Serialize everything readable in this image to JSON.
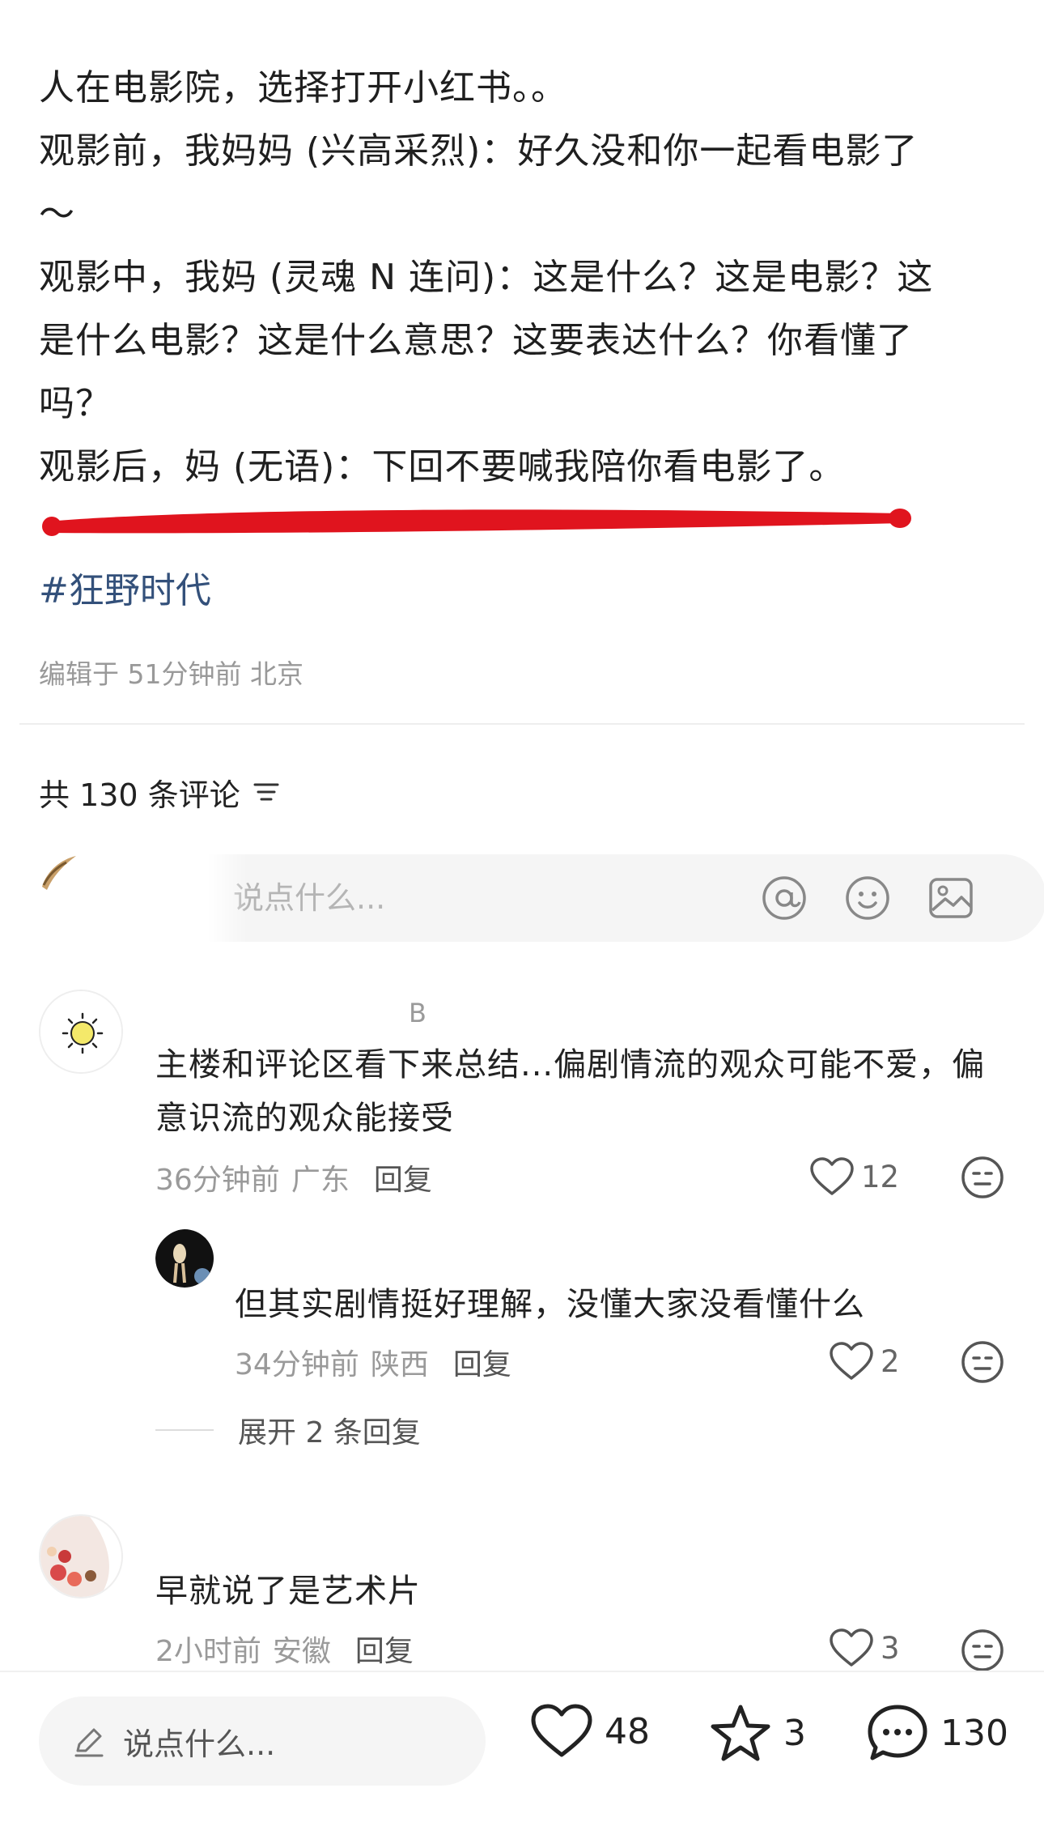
{
  "post": {
    "lines": [
      "人在电影院，选择打开小红书。。",
      "观影前，我妈妈 (兴高采烈)：好久没和你一起看电影了",
      "～",
      "观影中，我妈 (灵魂 N 连问)：这是什么？这是电影？这",
      "是什么电影？这是什么意思？这要表达什么？你看懂了",
      "吗？",
      "观影后，妈 (无语)：下回不要喊我陪你看电影了。"
    ],
    "hashtag": "#狂野时代",
    "meta": "编辑于 51分钟前 北京"
  },
  "comments_header": {
    "label": "共 130 条评论"
  },
  "comment_input": {
    "placeholder": "说点什么..."
  },
  "comments": [
    {
      "username": "B",
      "text_lines": [
        "主楼和评论区看下来总结...偏剧情流的观众可能不爱，偏",
        "意识流的观众能接受"
      ],
      "time": "36分钟前",
      "location": "广东",
      "reply_label": "回复",
      "likes": "12",
      "replies": [
        {
          "text": "但其实剧情挺好理解，没懂大家没看懂什么",
          "time": "34分钟前",
          "location": "陕西",
          "reply_label": "回复",
          "likes": "2"
        }
      ],
      "expand_label": "展开 2 条回复"
    },
    {
      "text": "早就说了是艺术片",
      "time": "2小时前",
      "location": "安徽",
      "reply_label": "回复",
      "likes": "3"
    }
  ],
  "bottom_bar": {
    "placeholder": "说点什么...",
    "likes": "48",
    "stars": "3",
    "comments": "130"
  },
  "colors": {
    "hashtag": "#33507a",
    "highlight_mark": "#e0141e",
    "muted_text": "#9a9a9a",
    "input_bg": "#f5f5f5"
  },
  "icons": [
    "filter-icon",
    "at-icon",
    "emoji-icon",
    "image-icon",
    "heart-icon",
    "dislike-icon",
    "pencil-icon",
    "star-icon",
    "comment-icon"
  ]
}
